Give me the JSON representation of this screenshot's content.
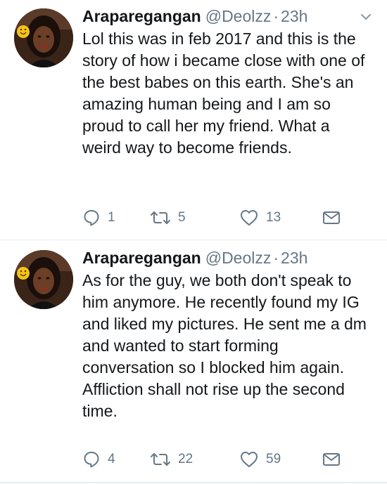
{
  "tweets": [
    {
      "display_name": "Araparegangan",
      "handle": "@Deolzz",
      "separator": "·",
      "time": "23h",
      "text": "Lol this was in feb 2017 and this is the story of how i became close with one of the best babes on this earth. She's an amazing human being and I am so proud to call her my friend. What a weird way to become friends.",
      "replies": "1",
      "retweets": "5",
      "likes": "13"
    },
    {
      "display_name": "Araparegangan",
      "handle": "@Deolzz",
      "separator": "·",
      "time": "23h",
      "text": "As for the guy, we both don't speak to him anymore. He recently found my IG and liked my pictures. He sent me a dm and wanted to start forming conversation so I blocked him again. Affliction shall not rise up the second time.",
      "replies": "4",
      "retweets": "22",
      "likes": "59"
    }
  ],
  "icons": {
    "reply": "reply-icon",
    "retweet": "retweet-icon",
    "like": "heart-icon",
    "dm": "envelope-icon",
    "caret": "chevron-down-icon"
  },
  "colors": {
    "text": "#14171a",
    "secondary": "#657786",
    "divider": "#e6ecf0"
  }
}
